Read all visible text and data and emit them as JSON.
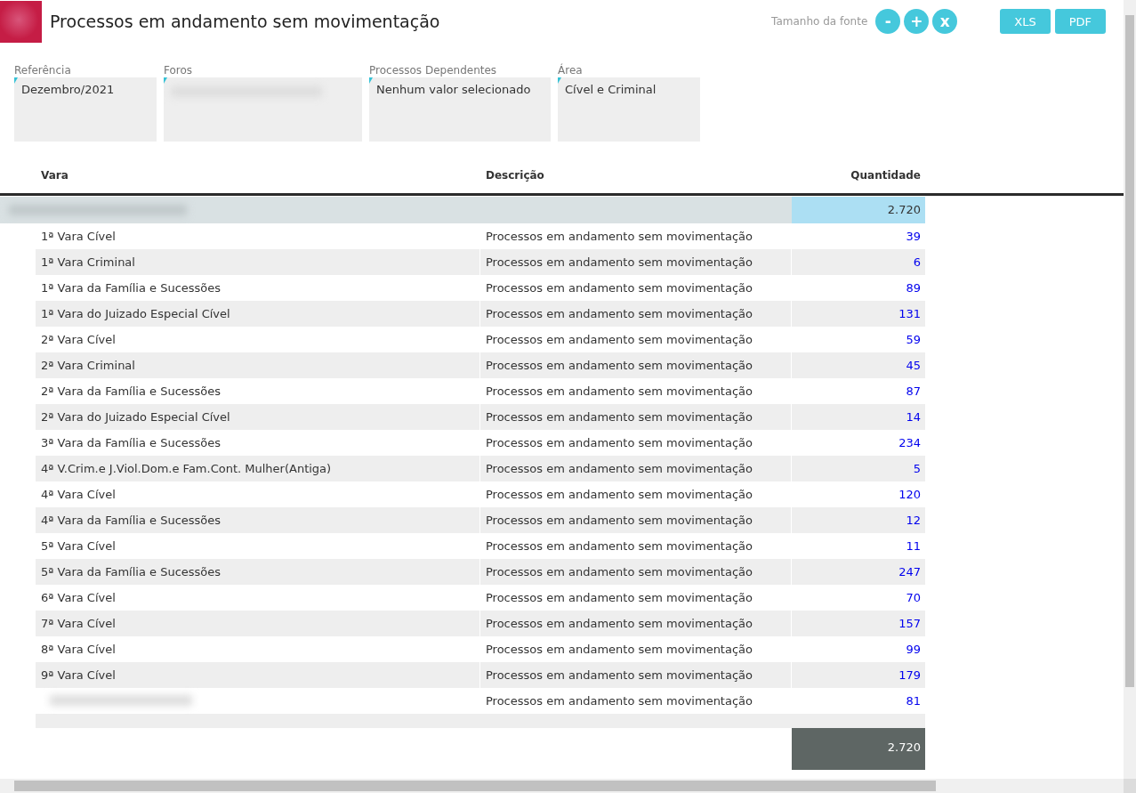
{
  "header": {
    "title": "Processos em andamento sem movimentação",
    "font_size_label": "Tamanho da fonte",
    "font_buttons": [
      "-",
      "+",
      "x"
    ],
    "export_buttons": [
      "XLS",
      "PDF"
    ]
  },
  "filters": [
    {
      "label": "Referência",
      "value": "Dezembro/2021"
    },
    {
      "label": "Foros"
    },
    {
      "label": "Processos Dependentes",
      "value": "Nenhum valor selecionado"
    },
    {
      "label": "Área",
      "value": "Cível e Criminal"
    }
  ],
  "table": {
    "columns": [
      "Vara",
      "Descrição",
      "Quantidade"
    ],
    "group": {
      "quantidade": "2.720"
    },
    "rows": [
      {
        "vara": "1ª Vara Cível",
        "descricao": "Processos em andamento sem movimentação",
        "quantidade": "39"
      },
      {
        "vara": "1ª Vara Criminal",
        "descricao": "Processos em andamento sem movimentação",
        "quantidade": "6"
      },
      {
        "vara": "1ª Vara da Família e Sucessões",
        "descricao": "Processos em andamento sem movimentação",
        "quantidade": "89"
      },
      {
        "vara": "1ª Vara do Juizado Especial Cível",
        "descricao": "Processos em andamento sem movimentação",
        "quantidade": "131"
      },
      {
        "vara": "2ª Vara Cível",
        "descricao": "Processos em andamento sem movimentação",
        "quantidade": "59"
      },
      {
        "vara": "2ª Vara Criminal",
        "descricao": "Processos em andamento sem movimentação",
        "quantidade": "45"
      },
      {
        "vara": "2ª Vara da Família e Sucessões",
        "descricao": "Processos em andamento sem movimentação",
        "quantidade": "87"
      },
      {
        "vara": "2ª Vara do Juizado Especial Cível",
        "descricao": "Processos em andamento sem movimentação",
        "quantidade": "14"
      },
      {
        "vara": "3ª Vara da Família e Sucessões",
        "descricao": "Processos em andamento sem movimentação",
        "quantidade": "234"
      },
      {
        "vara": "4ª V.Crim.e J.Viol.Dom.e Fam.Cont. Mulher(Antiga)",
        "descricao": "Processos em andamento sem movimentação",
        "quantidade": "5"
      },
      {
        "vara": "4ª Vara Cível",
        "descricao": "Processos em andamento sem movimentação",
        "quantidade": "120"
      },
      {
        "vara": "4ª Vara da Família e Sucessões",
        "descricao": "Processos em andamento sem movimentação",
        "quantidade": "12"
      },
      {
        "vara": "5ª Vara Cível",
        "descricao": "Processos em andamento sem movimentação",
        "quantidade": "11"
      },
      {
        "vara": "5ª Vara da Família e Sucessões",
        "descricao": "Processos em andamento sem movimentação",
        "quantidade": "247"
      },
      {
        "vara": "6ª Vara Cível",
        "descricao": "Processos em andamento sem movimentação",
        "quantidade": "70"
      },
      {
        "vara": "7ª Vara Cível",
        "descricao": "Processos em andamento sem movimentação",
        "quantidade": "157"
      },
      {
        "vara": "8ª Vara Cível",
        "descricao": "Processos em andamento sem movimentação",
        "quantidade": "99"
      },
      {
        "vara": "9ª Vara Cível",
        "descricao": "Processos em andamento sem movimentação",
        "quantidade": "179"
      },
      {
        "descricao": "Processos em andamento sem movimentação",
        "quantidade": "81"
      }
    ],
    "total": "2.720"
  }
}
